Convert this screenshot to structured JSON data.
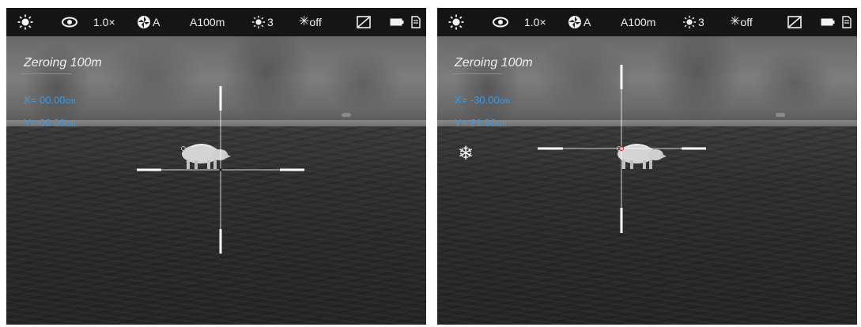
{
  "screens": [
    {
      "status": {
        "icons": [
          "sun-icon",
          "eye-icon",
          "aperture-icon",
          "brightness-icon",
          "sparkle-icon",
          "tilt-icon",
          "battery-icon",
          "sd-card-icon"
        ],
        "zoom": "1.0×",
        "calibration": "A",
        "profile": "A100m",
        "brightness": "3",
        "enhance": "off"
      },
      "title": "Zeroing 100m",
      "x_label": "X= 00.00",
      "x_unit": "cm",
      "y_label": "Y= 00.00",
      "y_unit": "cm",
      "freeze": false
    },
    {
      "status": {
        "icons": [
          "sun-icon",
          "eye-icon",
          "aperture-icon",
          "brightness-icon",
          "sparkle-icon",
          "tilt-icon",
          "battery-icon",
          "sd-card-icon"
        ],
        "zoom": "1.0×",
        "calibration": "A",
        "profile": "A100m",
        "brightness": "3",
        "enhance": "off"
      },
      "title": "Zeroing 100m",
      "x_label": "X= -30.00",
      "x_unit": "cm",
      "y_label": "Y= 21.00",
      "y_unit": "cm",
      "freeze": true,
      "freeze_icon": "snowflake-icon"
    }
  ],
  "colors": {
    "status_bar": "#000000",
    "status_text": "#f2f2f2",
    "coord_text": "#3c9be8",
    "reticle": "#ffffff",
    "underline": "#4aa3e0",
    "center_dot_active": "#e03030"
  }
}
